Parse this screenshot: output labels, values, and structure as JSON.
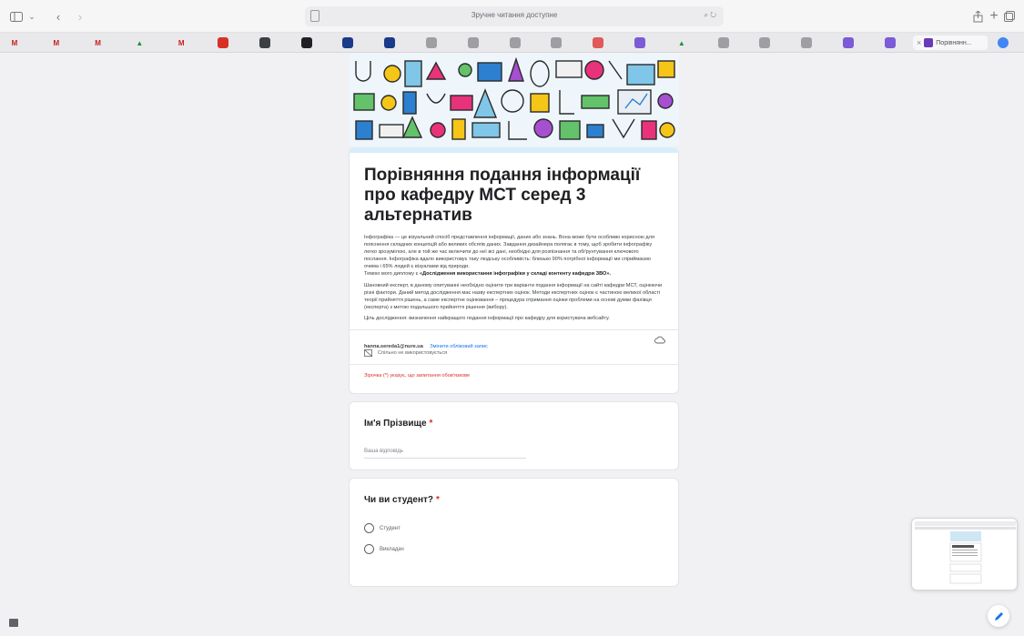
{
  "browser": {
    "url_text": "Зручне читання доступне",
    "active_tab_title": "Порівнянн...",
    "favicons": [
      {
        "letter": "M",
        "color": "#c5221f",
        "text": "#c5221f"
      },
      {
        "letter": "M",
        "color": "#c5221f",
        "text": "#c5221f"
      },
      {
        "letter": "M",
        "color": "#c5221f",
        "text": "#c5221f"
      },
      {
        "letter": "▲",
        "color": "#1e8e3e",
        "text": "#1e8e3e"
      },
      {
        "letter": "M",
        "color": "#c5221f",
        "text": "#c5221f"
      },
      {
        "letter": "",
        "color": "#d93025",
        "text": "#fff"
      },
      {
        "letter": "",
        "color": "#3c4043",
        "text": "#fff"
      },
      {
        "letter": "",
        "color": "#202124",
        "text": "#fff"
      },
      {
        "letter": "",
        "color": "#1a3a8a",
        "text": "#fff"
      },
      {
        "letter": "",
        "color": "#1a3a8a",
        "text": "#fff"
      },
      {
        "letter": "",
        "color": "#9e9ea3",
        "text": "#fff"
      },
      {
        "letter": "",
        "color": "#9e9ea3",
        "text": "#fff"
      },
      {
        "letter": "",
        "color": "#9e9ea3",
        "text": "#fff"
      },
      {
        "letter": "",
        "color": "#9e9ea3",
        "text": "#fff"
      },
      {
        "letter": "",
        "color": "#e05a5a",
        "text": "#fff"
      },
      {
        "letter": "",
        "color": "#7b5bd6",
        "text": "#fff"
      },
      {
        "letter": "▲",
        "color": "#1e8e3e",
        "text": "#1e8e3e"
      },
      {
        "letter": "",
        "color": "#9e9ea3",
        "text": "#fff"
      },
      {
        "letter": "",
        "color": "#9e9ea3",
        "text": "#fff"
      },
      {
        "letter": "",
        "color": "#9e9ea3",
        "text": "#fff"
      },
      {
        "letter": "",
        "color": "#7b5bd6",
        "text": "#fff"
      },
      {
        "letter": "",
        "color": "#7b5bd6",
        "text": "#fff"
      }
    ]
  },
  "form": {
    "title": "Порівняння подання інформації про кафедру МСТ серед 3 альтернатив",
    "desc_p1_text": "Інфографіка — це візуальний спосіб представлення інформації, даних або знань. Вона може бути особливо корисною для пояснення складних концепцій або великих обсягів даних. Завдання дизайнера полягає в тому, щоб зробити інфографіку легко зрозумілою, але в той же час включити до неї всі дані, необхідні для розпізнання та обґрунтування ключового послання. Інфографіка вдало використовує таку людську особливість: близько 90% потрібної інформації ми сприймаємо очима і 65% людей є візуалами від природи.",
    "desc_p1_prefix": "Темою мого диплому є ",
    "desc_p1_bold": "«Дослідження використання інфографіки у складі контенту кафедри ЗВО».",
    "desc_p2": "Шановний експерт, в даному опитуванні необхідно оцінити три варіанти подання інформації на сайті кафедри МСТ, оцінюючи різні фактори. Даний метод дослідження має назву експертних оцінок. Методи експертних оцінок є частиною великої області теорії прийняття рішень, а саме експертне оцінювання – процедура отримання оцінки проблеми на основі думки фахівця (експерта) з метою подальшого прийняття рішення (вибору).",
    "desc_p3": "Ціль дослідження: визначення найкращого подання інформації про кафедру для користувача вебсайту.",
    "email": "hanna.seredа1@nure.ua",
    "switch_account": "Змінити обліковий запис",
    "not_shared": "Спільно не використовується",
    "required_note": "Зірочка (*) указує, що запитання обов'язкове",
    "required_mark": "*",
    "q1_title": "Ім'я Прізвище",
    "q1_placeholder": "Ваша відповідь",
    "q2_title": "Чи ви студент?",
    "q2_options": [
      "Студент",
      "Викладач"
    ]
  }
}
